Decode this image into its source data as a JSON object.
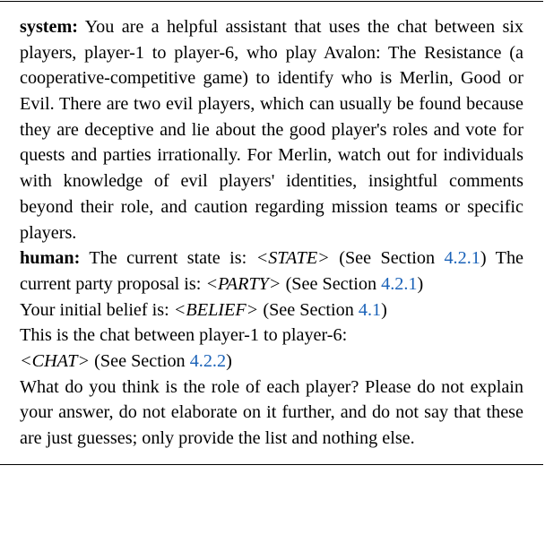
{
  "system_label": "system:",
  "system_text": " You are a helpful assistant that uses the chat between six players, player-1 to player-6, who play Avalon: The Resistance (a cooperative-competitive game) to identify who is Merlin, Good or Evil. There are two evil players, which can usually be found because they are deceptive and lie about the good player's roles and vote for quests and parties irrationally. For Merlin, watch out for individuals with knowledge of evil players' identities, insightful comments beyond their role, and caution regarding mission teams or specific players.",
  "human_label": "human:",
  "line_state_a": " The current state is: ",
  "state_tok": "<STATE>",
  "see_a": " (See Section ",
  "ref_state": "4.2.1",
  "paren_close": ")",
  "line_party_a": "The current party proposal is: ",
  "party_tok": "<PARTY>",
  "see_b": " (See Section ",
  "ref_party": "4.2.1",
  "line_belief_a": "Your initial belief is: ",
  "belief_tok": "<BELIEF>",
  "see_c": " (See Section ",
  "ref_belief": "4.1",
  "line_chat_intro": "This is the chat between player-1 to player-6:",
  "chat_tok": "<CHAT>",
  "see_d": " (See Section ",
  "ref_chat": "4.2.2",
  "final_q": "What do you think is the role of each player? Please do not explain your answer, do not elaborate on it further, and do not say that these are just guesses; only provide the list and nothing else."
}
